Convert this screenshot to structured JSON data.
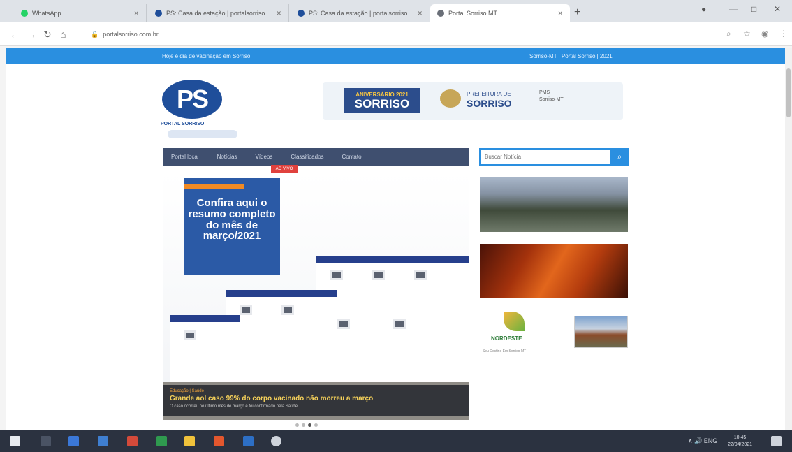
{
  "browser": {
    "tabs": [
      {
        "title": "WhatsApp",
        "color": "#25d366"
      },
      {
        "title": "PS: Casa da estação | portalsorriso",
        "color": "#1f4e9a"
      },
      {
        "title": "PS: Casa da estação | portalsorriso",
        "color": "#1f4e9a"
      },
      {
        "title": "Portal Sorriso MT",
        "color": "#6a6f78"
      }
    ],
    "new_tab": "+",
    "url": "portalsorriso.com.br",
    "window_controls": [
      "—",
      "□",
      "✕"
    ]
  },
  "topbar": {
    "left_text": "Hoje é dia de vacinação em Sorriso",
    "right_text": "Sorriso-MT | Portal Sorriso | 2021"
  },
  "logo": {
    "mark": "PS",
    "subtitle": "PORTAL SORRISO"
  },
  "banner": {
    "year_label": "ANIVERSÁRIO 2021",
    "city": "SORRISO",
    "prefeitura_label": "PREFEITURA DE",
    "prefeitura_city": "SORRISO",
    "extra_line1": "PMS",
    "extra_line2": "Sorriso-MT"
  },
  "nav": {
    "items": [
      "Portal local",
      "Notícias",
      "Vídeos",
      "Classificados",
      "Contato"
    ],
    "live_badge": "AO VIVO"
  },
  "search": {
    "placeholder": "Buscar Notícia",
    "button_icon": "search-icon"
  },
  "hero": {
    "promo_text": "Confira aqui o resumo completo do mês de março/2021",
    "caption_tag": "Educação | Saúde",
    "caption_title": "Grande aol caso 99% do corpo vacinado não morreu a março",
    "caption_sub": "O caso ocorreu no último mês de março e foi confirmado pela Saúde"
  },
  "sidebar": {
    "nordeste_title": "NORDESTE",
    "nordeste_sub": "Seu Destino Em Sorriso-MT"
  },
  "taskbar": {
    "time": "10:45",
    "date": "22/04/2021",
    "tray_text": "∧ 🔊 ENG"
  },
  "colors": {
    "brand_blue": "#2a8fe0",
    "nav_bg": "#3f4f6f",
    "live_red": "#e0413d"
  }
}
